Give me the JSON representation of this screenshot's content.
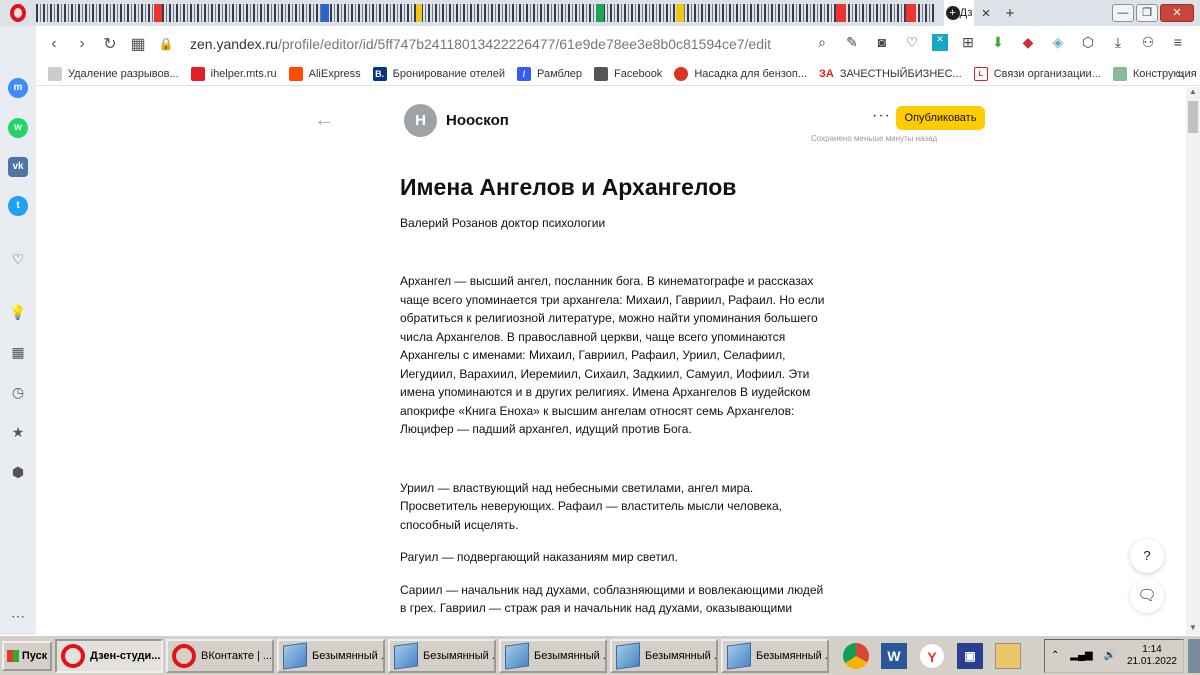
{
  "browser": {
    "url_host": "zen.yandex.ru",
    "url_path": "/profile/editor/id/5ff747b24118013422226477/61e9de78ee3e8b0c81594ce7/edit",
    "active_tab_label": "Дз",
    "colors": {
      "accent": "#e0121b",
      "publish": "#ffcc00"
    }
  },
  "bookmarks": [
    {
      "label": "Удаление разрывов...",
      "icon": "page-icon"
    },
    {
      "label": "ihelper.mts.ru",
      "icon": "mts-icon"
    },
    {
      "label": "AliExpress",
      "icon": "aliexpress-icon"
    },
    {
      "label": "Бронирование отелей",
      "icon": "booking-icon"
    },
    {
      "label": "Рамблер",
      "icon": "rambler-icon"
    },
    {
      "label": "Facebook",
      "icon": "page-icon"
    },
    {
      "label": "Насадка для бензоп...",
      "icon": "pin-icon"
    },
    {
      "label": "ЗАЧЕСТНЫЙБИЗНЕС...",
      "icon": "za-icon",
      "prefix": "ЗА"
    },
    {
      "label": "Связи организации...",
      "icon": "list-icon"
    },
    {
      "label": "Конструкция теплог...",
      "icon": "link-icon"
    }
  ],
  "editor": {
    "channel_initial": "Н",
    "channel_name": "Нооскоп",
    "publish_label": "Опубликовать",
    "saved_note": "Сохранено меньше минуты назад"
  },
  "article": {
    "title": "Имена Ангелов и Архангелов",
    "subtitle": "Валерий Розанов доктор психологии",
    "paragraphs": [
      "Архангел — высший ангел, посланник бога. В кинематографе и рассказах чаще всего упоминается три архангела: Михаил, Гавриил, Рафаил. Но если обратиться к религиозной литературе, можно найти упоминания большего числа Архангелов. В православной церкви, чаще всего упоминаются Архангелы с именами: Михаил, Гавриил, Рафаил, Уриил, Селафиил, Иегудиил, Варахиил, Иеремиил, Сихаил, Задкиил, Самуил, Иофиил. Эти имена упоминаются и в других религиях. Имена Архангелов В иудейском апокрифе «Книга Еноха» к высшим ангелам относят семь Архангелов: Люцифер — падший архангел, идущий против Бога.",
      "Уриил — властвующий над небесными светилами, ангел мира. Просветитель неверующих. Рафаил — властитель мысли человека, способный исцелять.",
      "Рагуил — подвергающий наказаниям мир светил.",
      "Сариил — начальник над духами, соблазняющими и вовлекающими людей в грех. Гавриил — страж рая и начальник над духами, оказывающими"
    ]
  },
  "floating": {
    "help_label": "?",
    "chat_label": "🗨"
  },
  "taskbar": {
    "start_label": "Пуск",
    "tasks": [
      {
        "label": "Дзен-студи...",
        "icon": "opera-icon",
        "active": true
      },
      {
        "label": "ВКонтакте | ...",
        "icon": "opera-icon",
        "active": false
      },
      {
        "label": "Безымянный ...",
        "icon": "paint-icon",
        "active": false
      },
      {
        "label": "Безымянный ...",
        "icon": "paint-icon",
        "active": false
      },
      {
        "label": "Безымянный ...",
        "icon": "paint-icon",
        "active": false
      },
      {
        "label": "Безымянный ...",
        "icon": "paint-icon",
        "active": false
      },
      {
        "label": "Безымянный ...",
        "icon": "paint-icon",
        "active": false
      }
    ],
    "time": "1:14",
    "date": "21.01.2022"
  }
}
